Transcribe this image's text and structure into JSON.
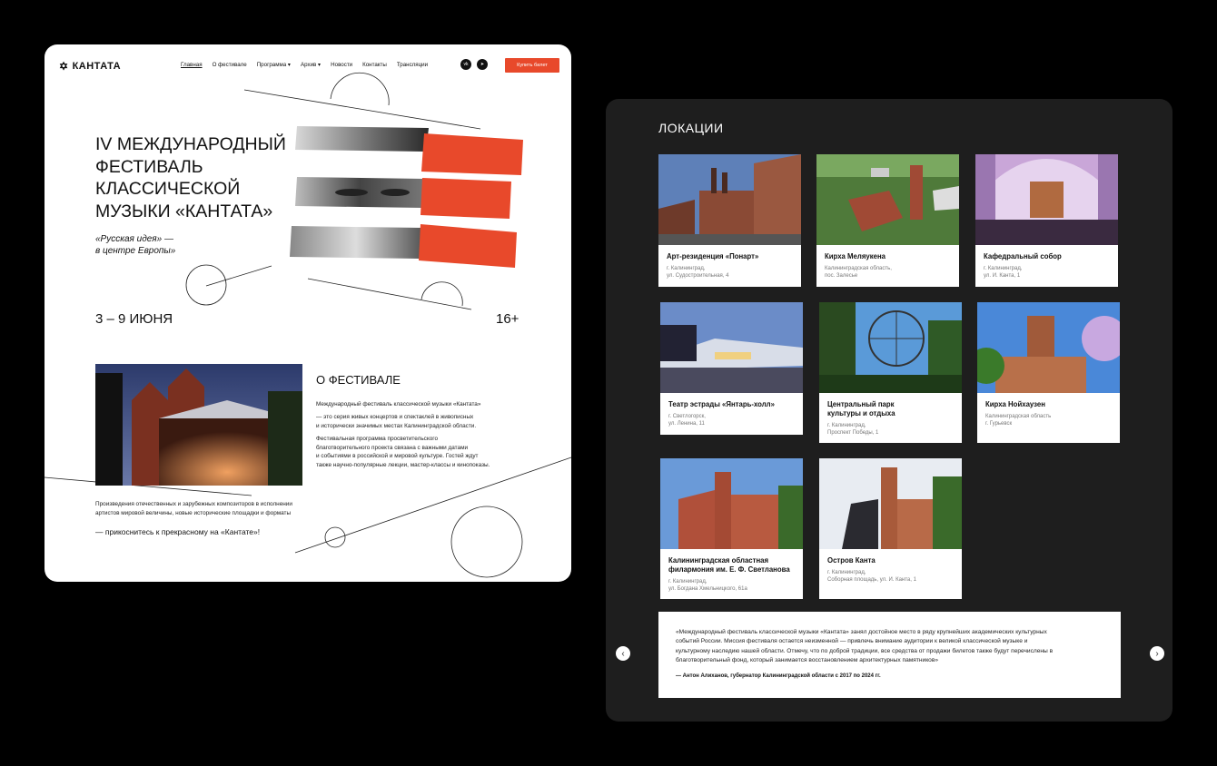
{
  "nav": {
    "logo": "КАНТАТА",
    "items": [
      "Главная",
      "О фестивале",
      "Программа ▾",
      "Архив ▾",
      "Новости",
      "Контакты",
      "Трансляции"
    ],
    "social": [
      "vk-icon",
      "telegram-icon"
    ],
    "buy_label": "Купить билет"
  },
  "hero": {
    "title_line1": "IV МЕЖДУНАРОДНЫЙ",
    "title_line2": "ФЕСТИВАЛЬ",
    "title_line3": "КЛАССИЧЕСКОЙ",
    "title_line4": "МУЗЫКИ «КАНТАТА»",
    "subtitle_line1": "«Русская идея» —",
    "subtitle_line2": "в центре Европы»",
    "dates": "3 – 9 ИЮНЯ",
    "age": "16+"
  },
  "about": {
    "heading": "О ФЕСТИВАЛЕ",
    "p1": "Международный фестиваль классической музыки «Кантата»",
    "p2_line1": "— это серия живых концертов и спектаклей в живописных",
    "p2_line2": "и исторически значимых местах Калининградской области.",
    "p3_line1": "Фестивальная программа просветительского",
    "p3_line2": "благотворительного проекта связана с важными датами",
    "p3_line3": "и событиями в российской и мировой культуре. Гостей ждут",
    "p3_line4": "также научно-популярные лекции, мастер-классы и кинопоказы.",
    "p4_line1": "Произведения отечественных и зарубежных композиторов в исполнении",
    "p4_line2": "артистов мировой величины, новые исторические площадки и форматы",
    "touch": "— прикоснитесь к прекрасному на «Кантате»!"
  },
  "locations": {
    "heading": "ЛОКАЦИИ",
    "items": [
      {
        "name1": "Арт-резиденция «Понарт»",
        "name2": "",
        "addr1": "г. Калининград,",
        "addr2": "ул. Судостроительная, 4"
      },
      {
        "name1": "Кирха Меляукена",
        "name2": "",
        "addr1": "Калининградская область,",
        "addr2": "пос. Залесье"
      },
      {
        "name1": "Кафедральный собор",
        "name2": "",
        "addr1": "г. Калининград,",
        "addr2": "ул. И. Канта, 1"
      },
      {
        "name1": "Театр эстрады «Янтарь-холл»",
        "name2": "",
        "addr1": "г. Светлогорск,",
        "addr2": "ул. Ленина, 11"
      },
      {
        "name1": "Центральный парк",
        "name2": "культуры и отдыха",
        "addr1": "г. Калининград,",
        "addr2": "Проспект Победы, 1"
      },
      {
        "name1": "Кирха Нойхаузен",
        "name2": "",
        "addr1": "Калининградская область",
        "addr2": "г. Гурьевск"
      },
      {
        "name1": "Калининградская областная",
        "name2": "филармония им. Е. Ф. Светланова",
        "addr1": "г. Калининград,",
        "addr2": "ул. Богдана Хмельницкого, 61а"
      },
      {
        "name1": "Остров Канта",
        "name2": "",
        "addr1": "г. Калининград,",
        "addr2": "Соборная площадь, ул. И. Канта, 1"
      }
    ]
  },
  "quote": {
    "line1": "«Международный фестиваль классической музыки «Кантата» занял достойное место в ряду крупнейших академических культурных",
    "line2": "событий России. Миссия фестиваля остается неизменной — привлечь внимание аудитории к великой классической музыке и",
    "line3": "культурному наследию нашей области. Отмечу, что по доброй традиции, все средства от продажи билетов также будут перечислены в",
    "line4": "благотворительный фонд, который занимается восстановлением архитектурных памятников»",
    "author": "— Антон Алиханов, губернатор Калининградской области с 2017 по 2024 гг."
  },
  "colors": {
    "accent": "#e8492b",
    "dark_panel": "#1e1e1e",
    "background": "#000000"
  }
}
